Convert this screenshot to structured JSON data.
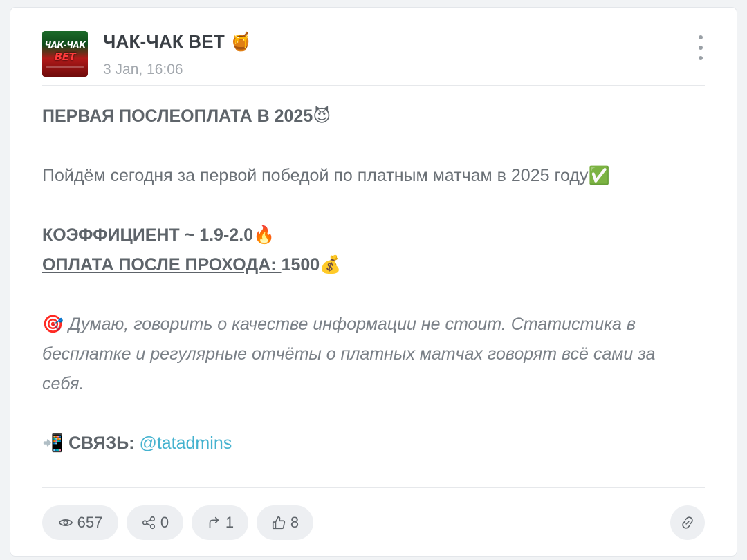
{
  "channel": {
    "name": "ЧАК-ЧАК BET",
    "name_emoji": "🍯",
    "avatar_line1": "ЧАК-ЧАК",
    "avatar_line2": "BET",
    "date": "3 Jan, 16:06"
  },
  "post": {
    "title": "ПЕРВАЯ ПОСЛЕОПЛАТА В 2025",
    "title_emoji": "😈",
    "line1": "Пойдём сегодня за первой победой по платным матчам в 2025 году",
    "line1_emoji": "✅",
    "coef_label": "КОЭФФИЦИЕНТ",
    "coef_value": " ~ 1.9-2.0",
    "coef_emoji": "🔥",
    "pay_label": "ОПЛАТА ПОСЛЕ ПРОХОДА: ",
    "pay_value": "1500",
    "pay_emoji": "💰",
    "quote_emoji": "🎯",
    "quote_text": " Думаю, говорить о качестве информации не стоит. Статистика в бесплатке и регулярные отчёты о платных матчах говорят всё сами за себя.",
    "contact_emoji": "📲",
    "contact_label": " СВЯЗЬ: ",
    "contact_link": "@tatadmins"
  },
  "stats": {
    "views": "657",
    "shares": "0",
    "forwards": "1",
    "reactions": "8"
  },
  "colors": {
    "link": "#44b2cf",
    "text": "#6b7177",
    "pill_bg": "#edeff2"
  }
}
